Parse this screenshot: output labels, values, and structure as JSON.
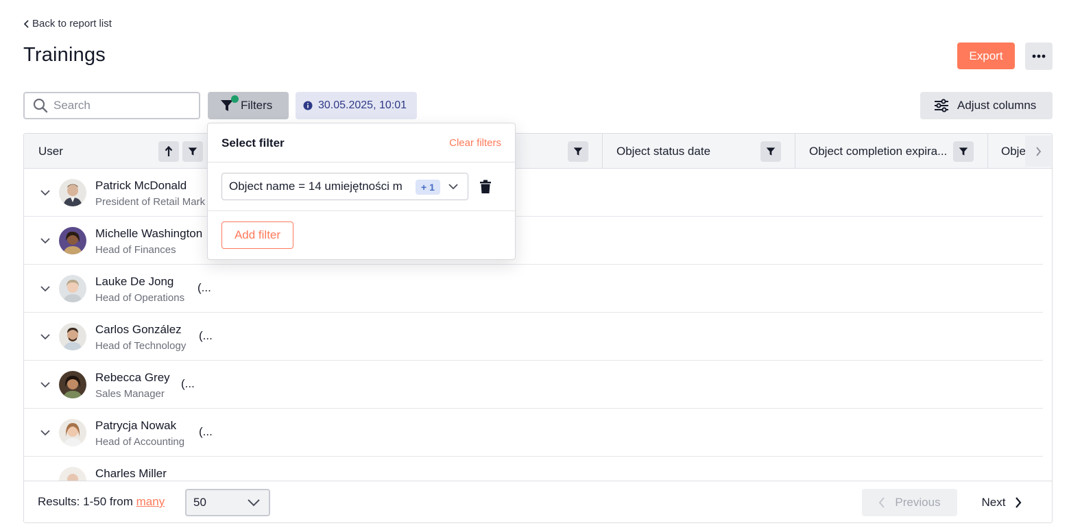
{
  "header": {
    "back_label": "Back to report list",
    "title": "Trainings",
    "export_label": "Export"
  },
  "toolbar": {
    "search_placeholder": "Search",
    "filters_label": "Filters",
    "date_label": "30.05.2025, 10:01",
    "adjust_columns_label": "Adjust columns",
    "filter_active_color": "#1e9e6a"
  },
  "table": {
    "columns": [
      "User",
      "Object status date",
      "Object completion expira...",
      "Obje"
    ],
    "rows": [
      {
        "name": "Patrick McDonald",
        "role": "President of Retail Mark"
      },
      {
        "name": "Michelle Washington",
        "role": "Head of Finances"
      },
      {
        "name": "Lauke De Jong",
        "role": "Head of Operations",
        "extra": "(..."
      },
      {
        "name": "Carlos González",
        "role": "Head of Technology",
        "extra": "(..."
      },
      {
        "name": "Rebecca Grey",
        "role": "Sales Manager",
        "extra": "(..."
      },
      {
        "name": "Patrycja Nowak",
        "role": "Head of Accounting",
        "extra": "(..."
      },
      {
        "name": "Charles Miller",
        "role": ""
      }
    ]
  },
  "footer": {
    "results_prefix": "Results: 1-50 from",
    "results_link": "many",
    "per_page": "50",
    "previous_label": "Previous",
    "next_label": "Next"
  },
  "filter_popover": {
    "title": "Select filter",
    "clear_label": "Clear filters",
    "filter_value": "Object name = 14 umiejętności m",
    "extra_count": "+ 1",
    "add_label": "Add filter"
  },
  "colors": {
    "accent": "#ff7a5a",
    "date_chip_text": "#2e3a86"
  }
}
